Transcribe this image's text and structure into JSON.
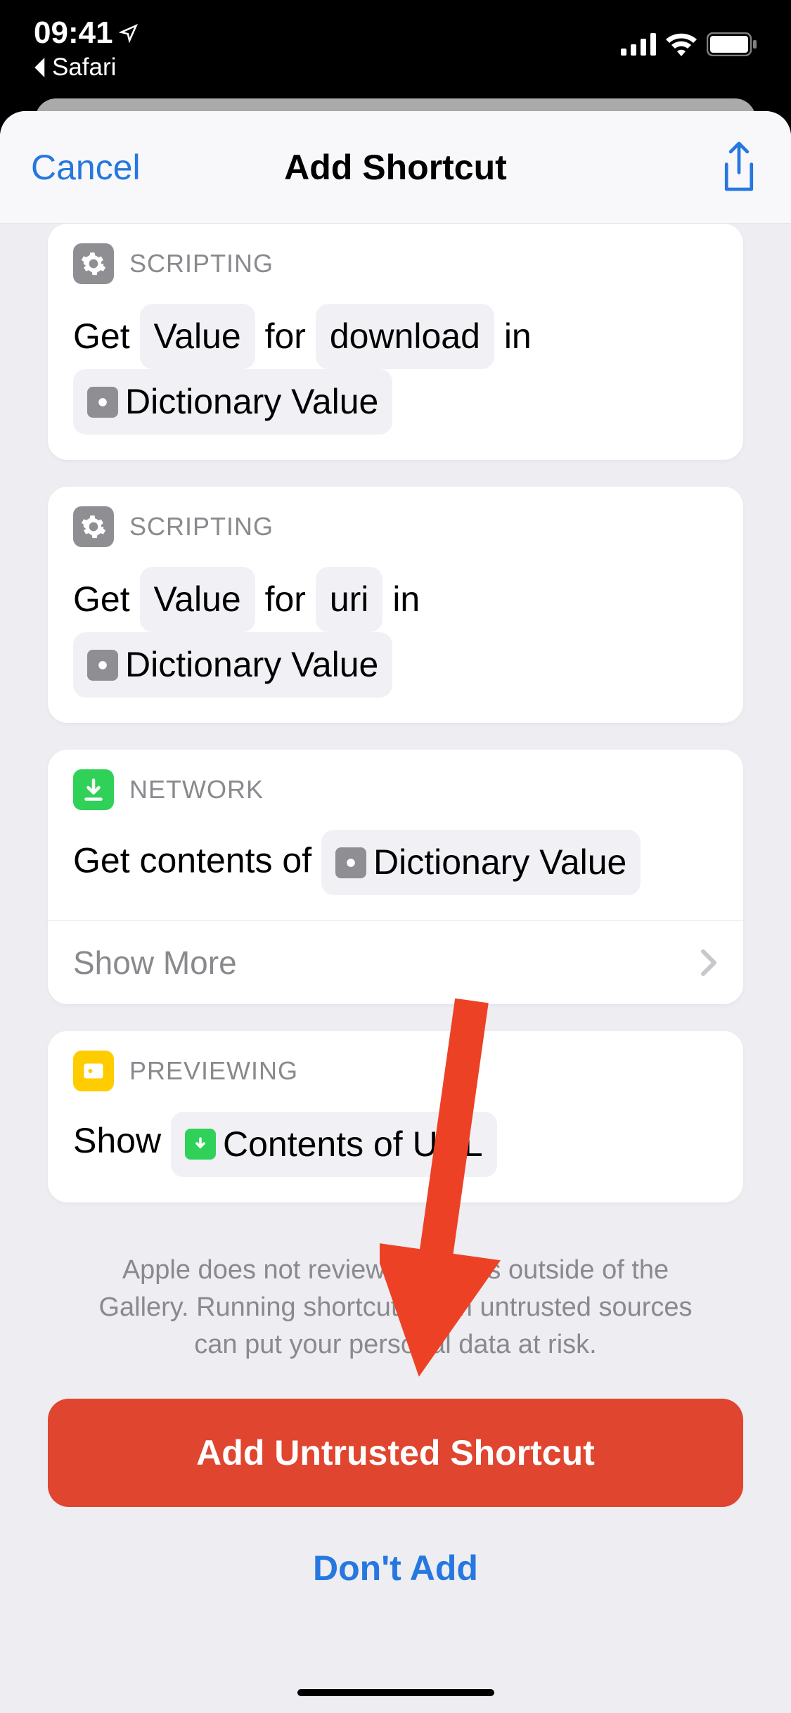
{
  "status": {
    "time": "09:41",
    "back_label": "Safari"
  },
  "navbar": {
    "cancel": "Cancel",
    "title": "Add Shortcut"
  },
  "actions": [
    {
      "category": "SCRIPTING",
      "icon": "gear",
      "tokens": [
        "Get",
        "pill:Value",
        "for",
        "pill:download",
        "in",
        "pillicon:gear:Dictionary Value"
      ]
    },
    {
      "category": "SCRIPTING",
      "icon": "gear",
      "tokens": [
        "Get",
        "pill:Value",
        "for",
        "pill:uri",
        "in",
        "pillicon:gear:Dictionary Value"
      ]
    },
    {
      "category": "NETWORK",
      "icon": "download",
      "tokens": [
        "Get contents of",
        "pillicon:gear:Dictionary Value"
      ],
      "showMore": "Show More"
    },
    {
      "category": "PREVIEWING",
      "icon": "preview",
      "tokens": [
        "Show",
        "pillicon:download:Contents of URL"
      ]
    }
  ],
  "warning": "Apple does not review shortcuts outside of the Gallery. Running shortcuts from untrusted sources can put your personal data at risk.",
  "buttons": {
    "add": "Add Untrusted Shortcut",
    "dontAdd": "Don't Add"
  },
  "colors": {
    "accent_blue": "#2677e0",
    "danger_red": "#e0452f",
    "icon_gray": "#8e8e93",
    "icon_green": "#30d158",
    "icon_yellow": "#ffcc00"
  }
}
